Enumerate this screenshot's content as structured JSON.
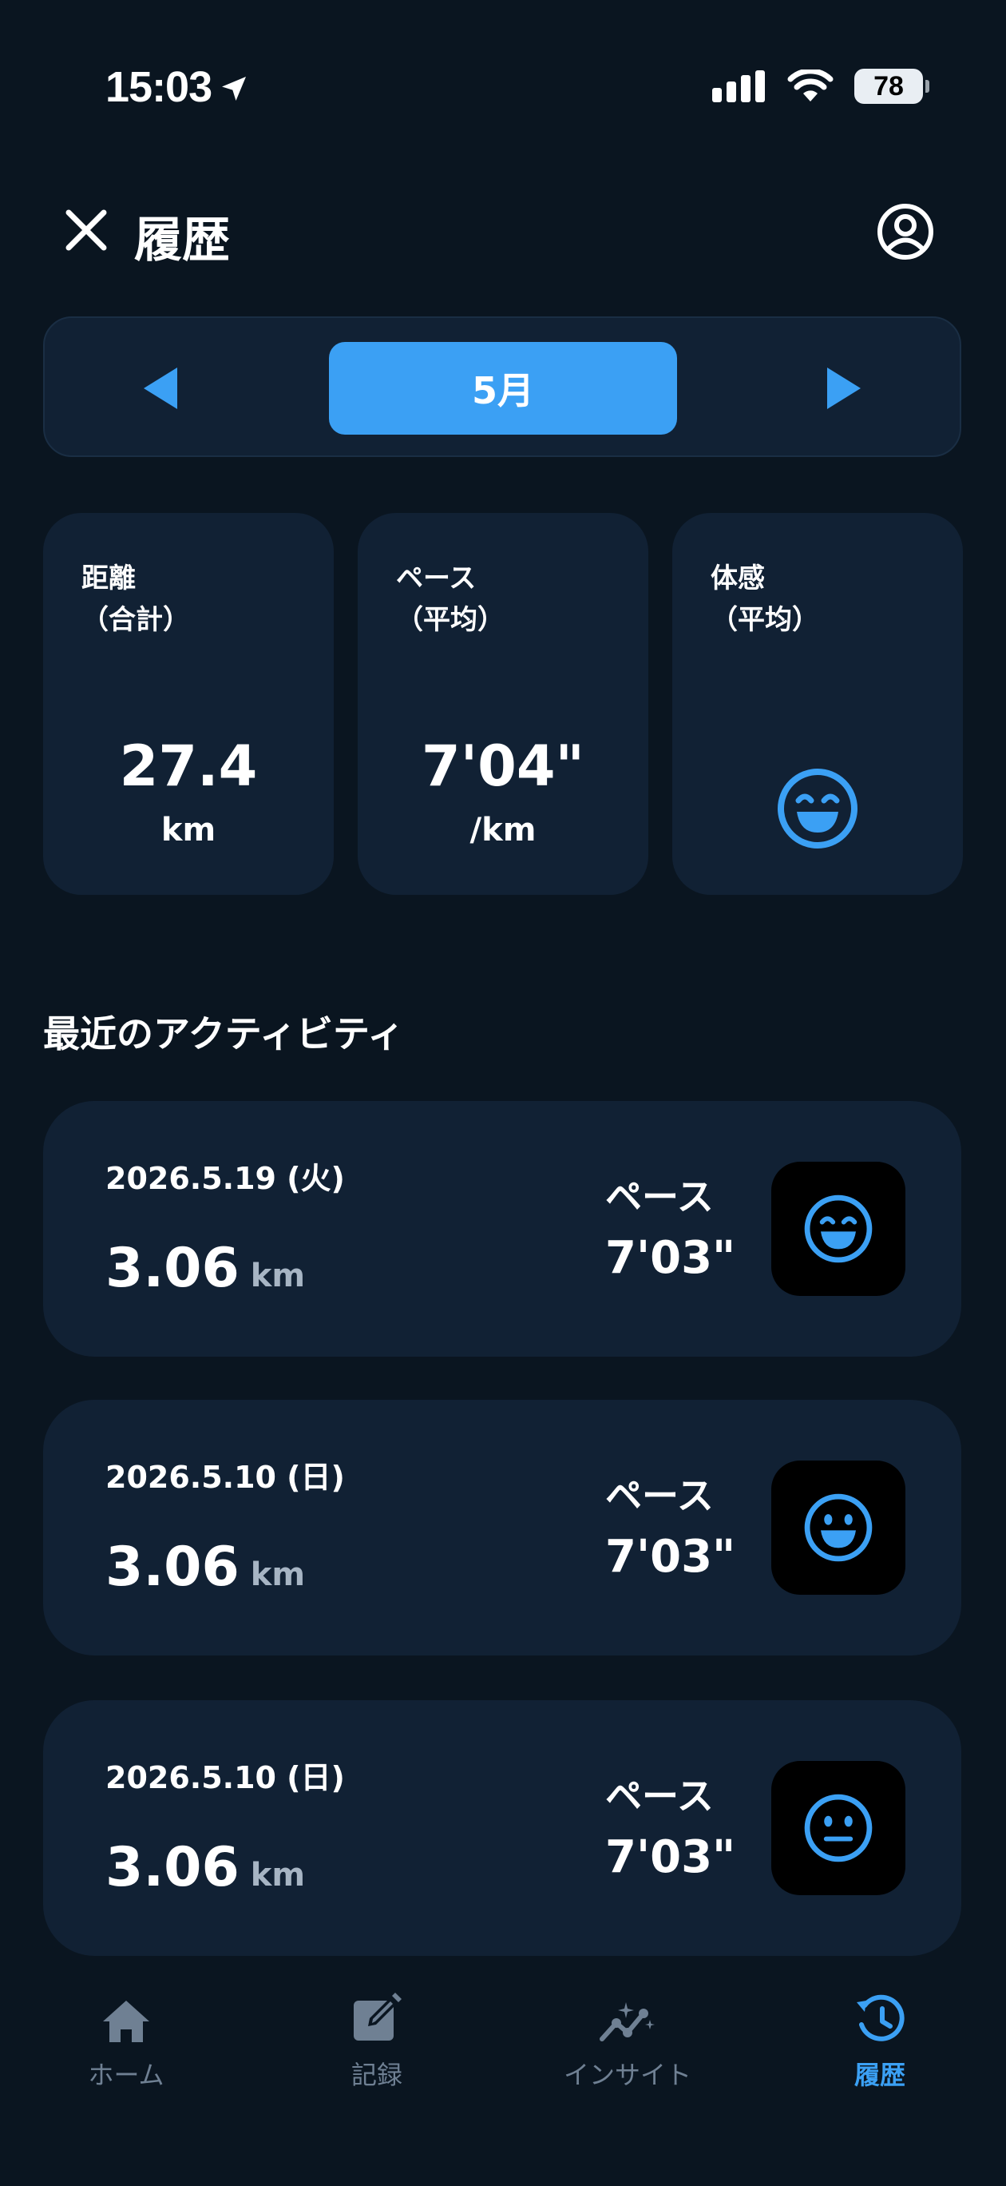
{
  "status_bar": {
    "time": "15:03",
    "battery": "78"
  },
  "header": {
    "title": "履歴"
  },
  "month_selector": {
    "current": "5月"
  },
  "stats": [
    {
      "label_line1": "距離",
      "label_line2": "（合計）",
      "value": "27.4",
      "unit": "km"
    },
    {
      "label_line1": "ペース",
      "label_line2": "（平均）",
      "value": "7'04\"",
      "unit": "/km"
    },
    {
      "label_line1": "体感",
      "label_line2": "（平均）",
      "mood_icon": "laughing-face-icon"
    }
  ],
  "recent": {
    "title": "最近のアクティビティ",
    "items": [
      {
        "date": "2026.5.19 (火)",
        "distance": "3.06",
        "unit": "km",
        "pace_label": "ペース",
        "pace": "7'03\"",
        "mood_icon": "laughing-face-icon"
      },
      {
        "date": "2026.5.10 (日)",
        "distance": "3.06",
        "unit": "km",
        "pace_label": "ペース",
        "pace": "7'03\"",
        "mood_icon": "smiling-face-icon"
      },
      {
        "date": "2026.5.10 (日)",
        "distance": "3.06",
        "unit": "km",
        "pace_label": "ペース",
        "pace": "7'03\"",
        "mood_icon": "neutral-face-icon"
      }
    ]
  },
  "tabs": [
    {
      "label": "ホーム",
      "icon": "home-icon",
      "active": false
    },
    {
      "label": "記録",
      "icon": "edit-icon",
      "active": false
    },
    {
      "label": "インサイト",
      "icon": "insight-icon",
      "active": false
    },
    {
      "label": "履歴",
      "icon": "history-icon",
      "active": true
    }
  ],
  "colors": {
    "background": "#0a1520",
    "card": "#112134",
    "accent": "#3ba0f4",
    "inactive": "#6f8093"
  }
}
